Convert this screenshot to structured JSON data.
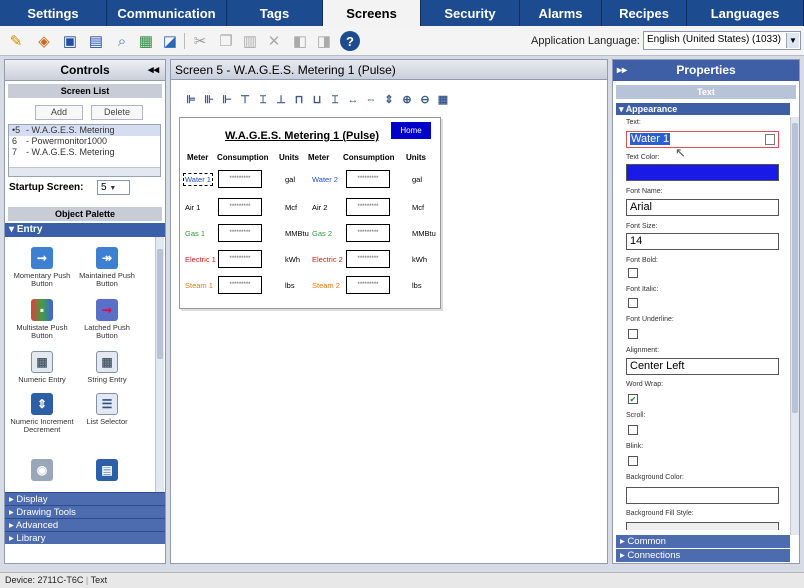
{
  "tabs": [
    "Settings",
    "Communication",
    "Tags",
    "Screens",
    "Security",
    "Alarms",
    "Recipes",
    "Languages"
  ],
  "active_tab": "Screens",
  "toolbar": {
    "icons": [
      "new-wizard-icon",
      "open-icon",
      "save-icon",
      "save-as-icon",
      "find-icon",
      "screenshot-icon",
      "preview-icon",
      "cut-icon",
      "copy-icon",
      "paste-icon",
      "delete-icon",
      "undo-icon",
      "redo-icon",
      "help-icon"
    ],
    "app_language_label": "Application Language:",
    "app_language_value": "English (United States) (1033)"
  },
  "controls": {
    "title": "Controls",
    "screen_list_title": "Screen List",
    "add_label": "Add",
    "delete_label": "Delete",
    "screens": [
      {
        "num": "5",
        "name": "- W.A.G.E.S. Metering",
        "selected": true
      },
      {
        "num": "6",
        "name": "- Powermonitor1000",
        "selected": false
      },
      {
        "num": "7",
        "name": "- W.A.G.E.S. Metering",
        "selected": false
      }
    ],
    "startup_label": "Startup Screen:",
    "startup_value": "5",
    "palette_title": "Object Palette",
    "category_open": "Entry",
    "palette_items": [
      {
        "label": "Momentary Push Button",
        "icon": "momentary-push-button-icon"
      },
      {
        "label": "Maintained Push Button",
        "icon": "maintained-push-button-icon"
      },
      {
        "label": "Multistate Push Button",
        "icon": "multistate-push-button-icon"
      },
      {
        "label": "Latched Push Button",
        "icon": "latched-push-button-icon"
      },
      {
        "label": "Numeric Entry",
        "icon": "numeric-entry-icon"
      },
      {
        "label": "String Entry",
        "icon": "string-entry-icon"
      },
      {
        "label": "Numeric Increment Decrement",
        "icon": "numeric-increment-decrement-icon"
      },
      {
        "label": "List Selector",
        "icon": "list-selector-icon"
      }
    ],
    "categories_collapsed": [
      "Display",
      "Drawing Tools",
      "Advanced",
      "Library"
    ]
  },
  "canvas": {
    "title": "Screen 5 - W.A.G.E.S. Metering 1 (Pulse)",
    "screen_title": "W.A.G.E.S. Metering 1 (Pulse)",
    "home_label": "Home",
    "headers": [
      "Meter",
      "Consumption",
      "Units",
      "Meter",
      "Consumption",
      "Units"
    ],
    "value_placeholder": "*********",
    "rows": [
      {
        "left": "Water 1",
        "left_unit": "gal",
        "right": "Water 2",
        "right_unit": "gal",
        "color": "#2050c8"
      },
      {
        "left": "Air 1",
        "left_unit": "Mcf",
        "right": "Air 2",
        "right_unit": "Mcf",
        "color": "#000000"
      },
      {
        "left": "Gas 1",
        "left_unit": "MMBtu",
        "right": "Gas 2",
        "right_unit": "MMBtu",
        "color": "#2e9a3a"
      },
      {
        "left": "Electric 1",
        "left_unit": "kWh",
        "right": "Electric 2",
        "right_unit": "kWh",
        "color": "#d02020"
      },
      {
        "left": "Steam 1",
        "left_unit": "lbs",
        "right": "Steam 2",
        "right_unit": "lbs",
        "color": "#e07a10"
      }
    ]
  },
  "properties": {
    "title": "Properties",
    "subtitle": "Text",
    "section": "Appearance",
    "text_label": "Text:",
    "text_value": "Water 1",
    "text_color_label": "Text Color:",
    "text_color": "#1a1ae6",
    "font_name_label": "Font Name:",
    "font_name": "Arial",
    "font_size_label": "Font Size:",
    "font_size": "14",
    "font_bold_label": "Font Bold:",
    "font_bold": false,
    "font_italic_label": "Font Italic:",
    "font_italic": false,
    "font_underline_label": "Font Underline:",
    "font_underline": false,
    "alignment_label": "Alignment:",
    "alignment": "Center Left",
    "word_wrap_label": "Word Wrap:",
    "word_wrap": true,
    "scroll_label": "Scroll:",
    "scroll": false,
    "blink_label": "Blink:",
    "blink": false,
    "bg_color_label": "Background Color:",
    "bg_fill_label": "Background Fill Style:",
    "common_label": "Common",
    "connections_label": "Connections"
  },
  "status": {
    "device": "Device: 2711C-T6C",
    "object": "Text"
  }
}
